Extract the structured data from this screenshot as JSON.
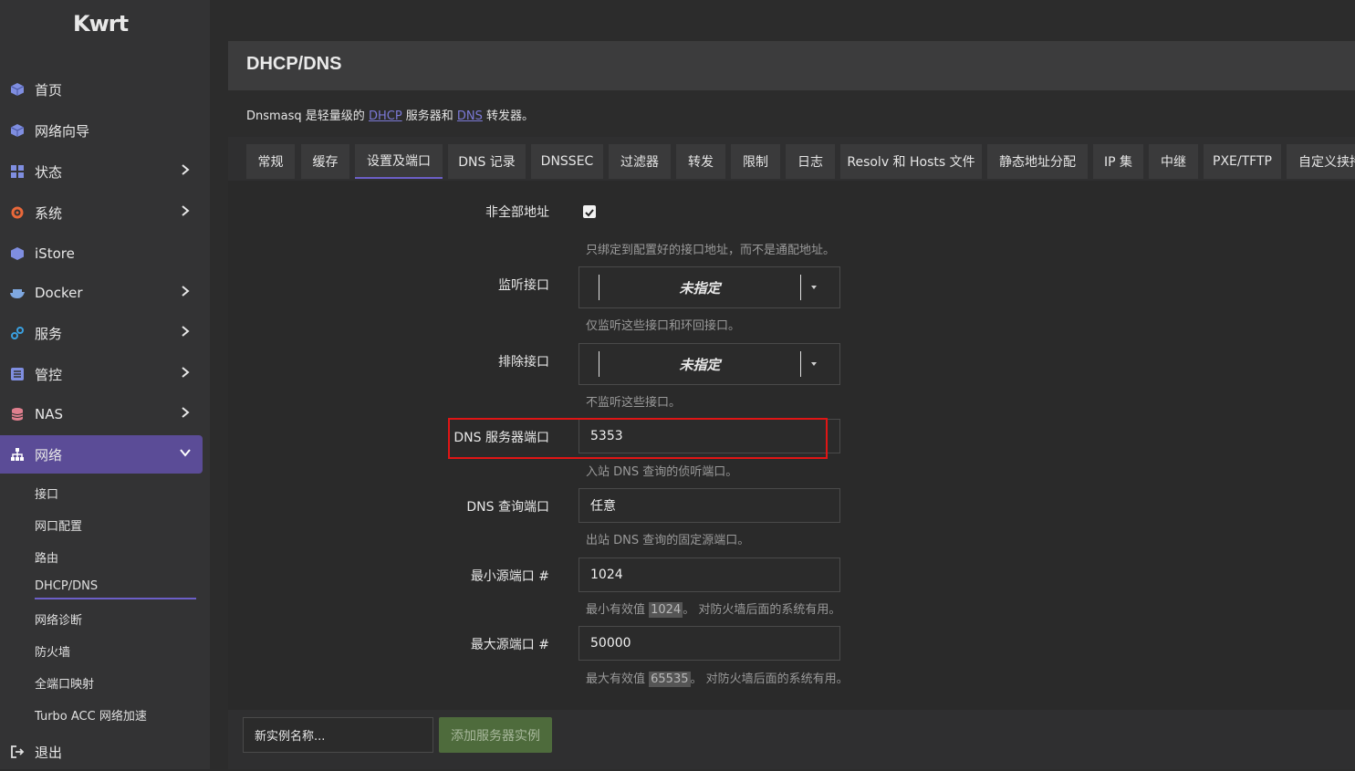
{
  "app": {
    "logo": "Kwrt"
  },
  "sidebar": {
    "items": [
      {
        "label": "首页"
      },
      {
        "label": "网络向导"
      },
      {
        "label": "状态"
      },
      {
        "label": "系统"
      },
      {
        "label": "iStore"
      },
      {
        "label": "Docker"
      },
      {
        "label": "服务"
      },
      {
        "label": "管控"
      },
      {
        "label": "NAS"
      },
      {
        "label": "网络"
      },
      {
        "label": "退出"
      }
    ],
    "subitems": [
      {
        "label": "接口"
      },
      {
        "label": "网口配置"
      },
      {
        "label": "路由"
      },
      {
        "label": "DHCP/DNS"
      },
      {
        "label": "网络诊断"
      },
      {
        "label": "防火墙"
      },
      {
        "label": "全端口映射"
      },
      {
        "label": "Turbo ACC 网络加速"
      }
    ]
  },
  "page": {
    "title": "DHCP/DNS",
    "desc_pre": "Dnsmasq 是轻量级的 ",
    "desc_link1": "DHCP",
    "desc_mid": " 服务器和 ",
    "desc_link2": "DNS",
    "desc_post": " 转发器。"
  },
  "tabs": [
    {
      "label": "常规"
    },
    {
      "label": "缓存"
    },
    {
      "label": "设置及端口"
    },
    {
      "label": "DNS 记录"
    },
    {
      "label": "DNSSEC"
    },
    {
      "label": "过滤器"
    },
    {
      "label": "转发"
    },
    {
      "label": "限制"
    },
    {
      "label": "日志"
    },
    {
      "label": "Resolv 和 Hosts 文件"
    },
    {
      "label": "静态地址分配"
    },
    {
      "label": "IP 集"
    },
    {
      "label": "中继"
    },
    {
      "label": "PXE/TFTP"
    },
    {
      "label": "自定义挟持"
    }
  ],
  "form": {
    "nonwildcard": {
      "label": "非全部地址",
      "checked": true,
      "hint": "只绑定到配置好的接口地址，而不是通配地址。"
    },
    "listen": {
      "label": "监听接口",
      "value": "未指定",
      "hint": "仅监听这些接口和环回接口。"
    },
    "exclude": {
      "label": "排除接口",
      "value": "未指定",
      "hint": "不监听这些接口。"
    },
    "dns_port": {
      "label": "DNS 服务器端口",
      "value": "5353",
      "hint": "入站 DNS 查询的侦听端口。"
    },
    "query_port": {
      "label": "DNS 查询端口",
      "value": "任意",
      "hint": "出站 DNS 查询的固定源端口。"
    },
    "min_port": {
      "label": "最小源端口 #",
      "value": "1024",
      "hint_pre": "最小有效值 ",
      "hint_code": "1024",
      "hint_post": "。 对防火墙后面的系统有用。"
    },
    "max_port": {
      "label": "最大源端口 #",
      "value": "50000",
      "hint_pre": "最大有效值 ",
      "hint_code": "65535",
      "hint_post": "。 对防火墙后面的系统有用。"
    }
  },
  "footer": {
    "new_instance_placeholder": "新实例名称...",
    "add_button": "添加服务器实例"
  },
  "colors": {
    "accent": "#5b4c97",
    "highlight": "#e01515",
    "add_button": "#4e6b3c"
  }
}
